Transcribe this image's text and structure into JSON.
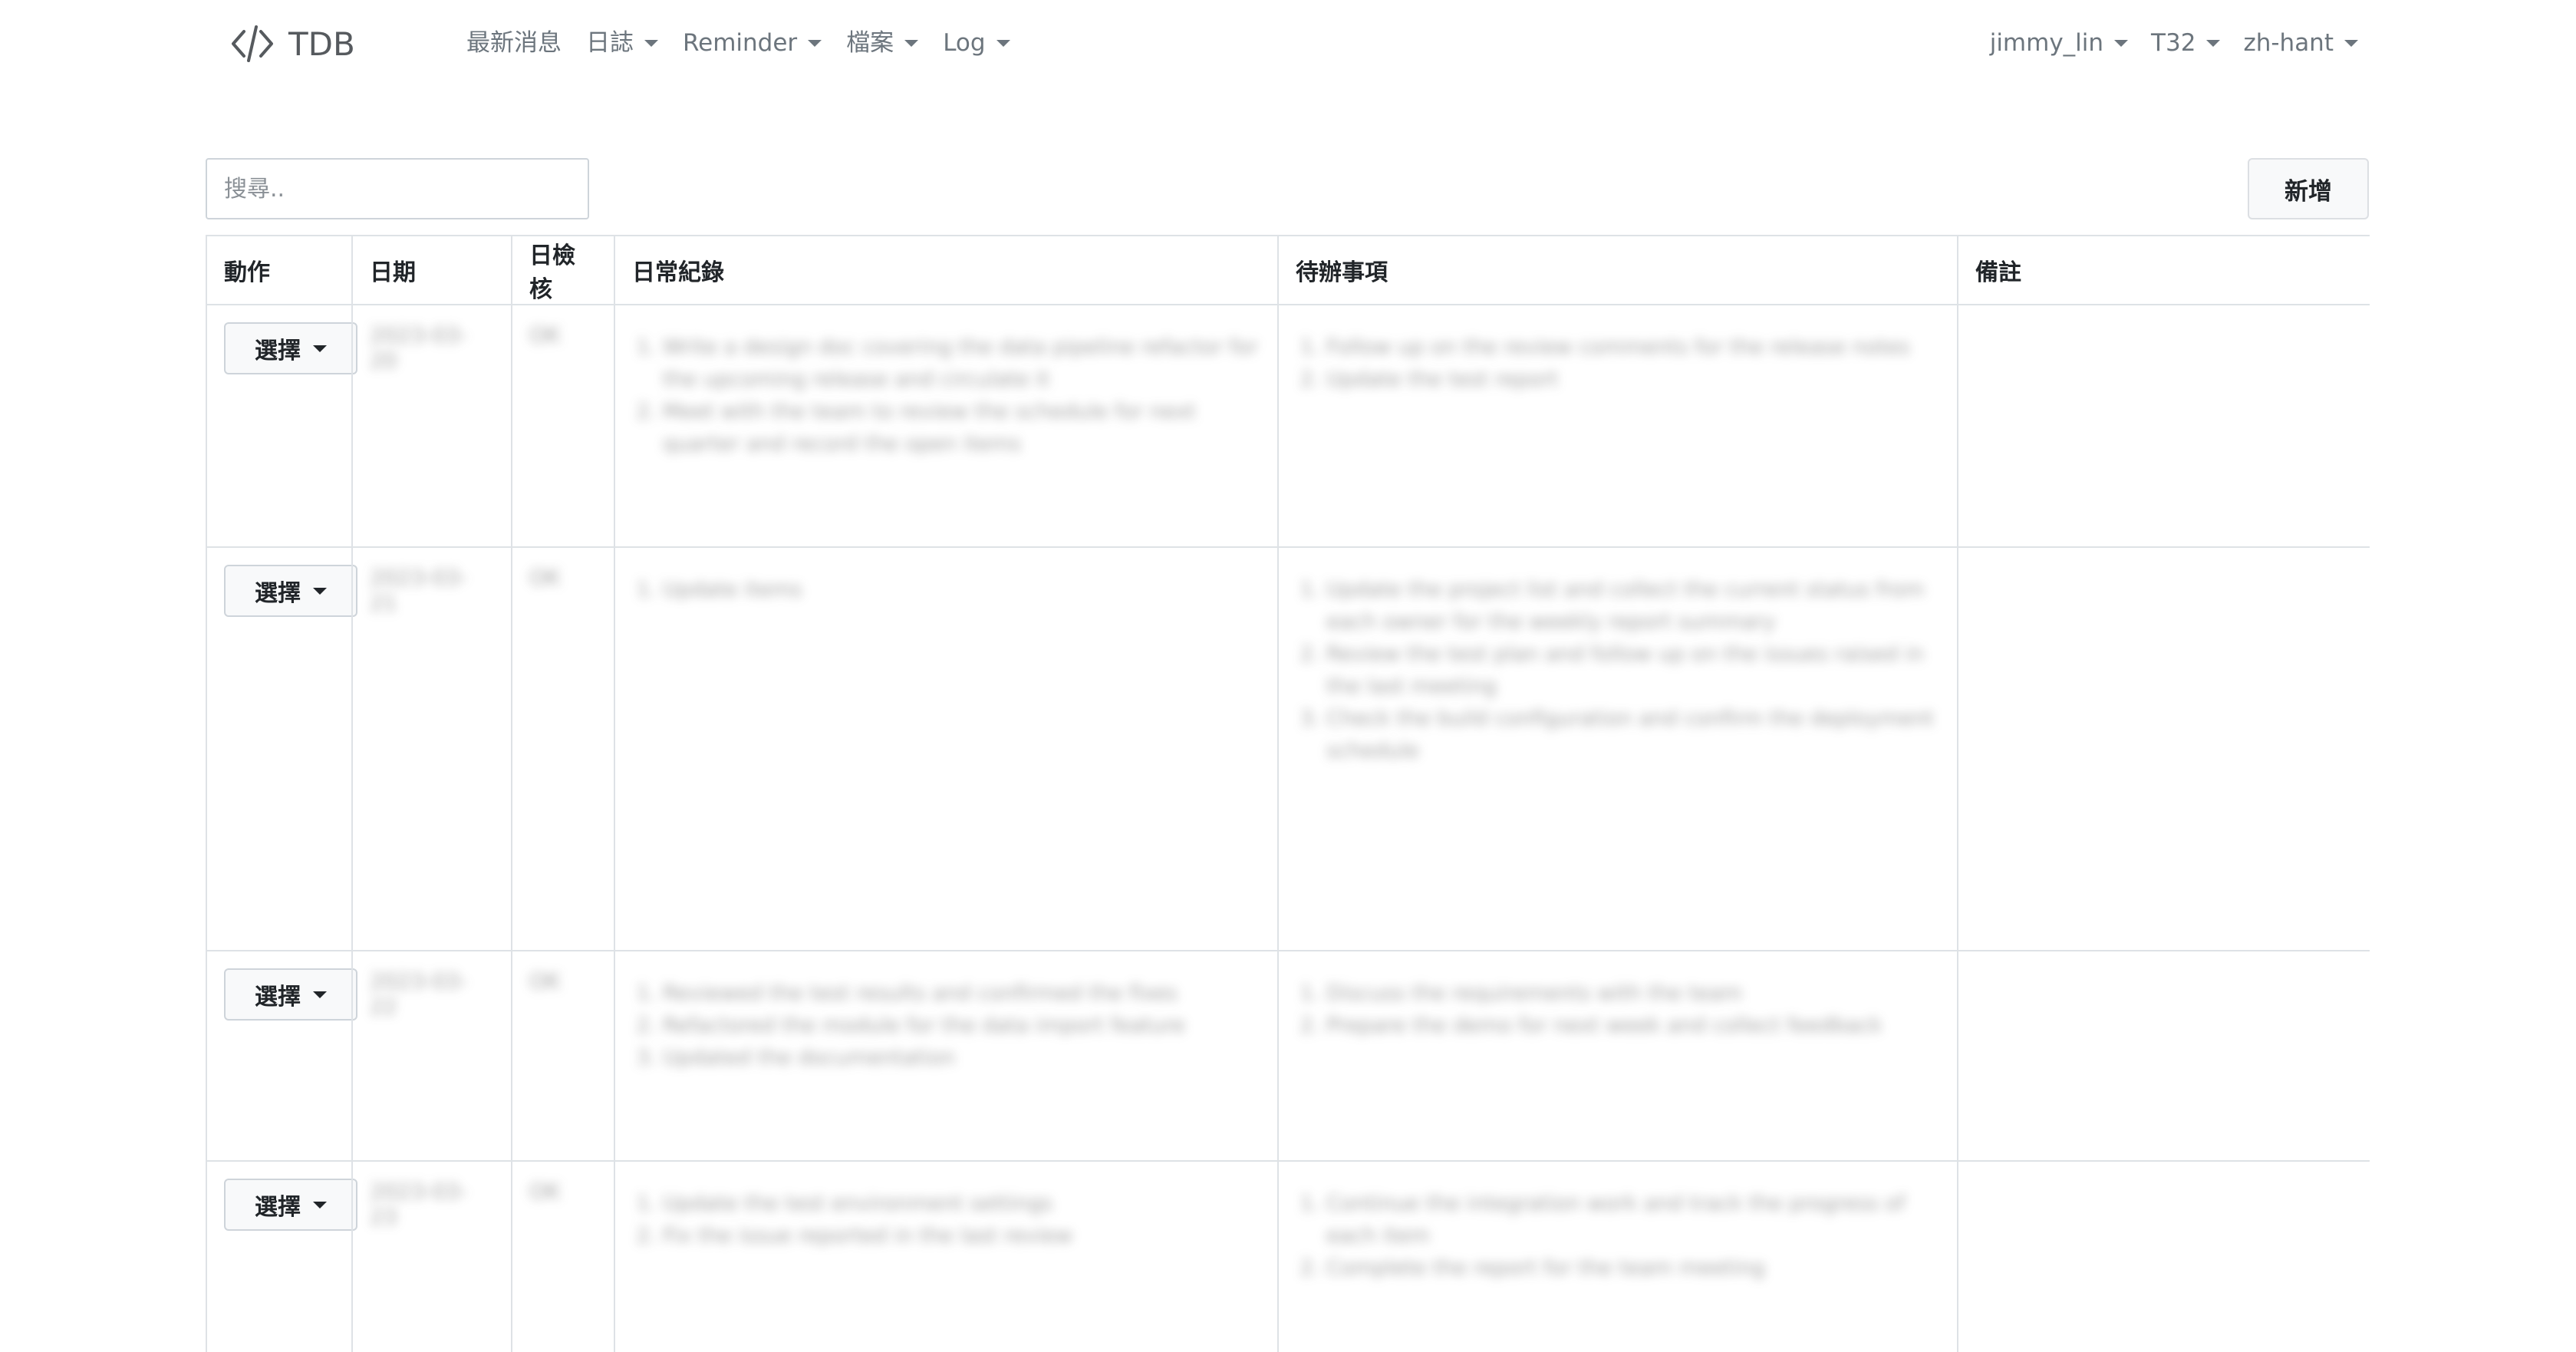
{
  "brand": {
    "text": "TDB"
  },
  "nav": {
    "left": [
      {
        "label": "最新消息",
        "dropdown": false
      },
      {
        "label": "日誌",
        "dropdown": true
      },
      {
        "label": "Reminder",
        "dropdown": true
      },
      {
        "label": "檔案",
        "dropdown": true
      },
      {
        "label": "Log",
        "dropdown": true
      }
    ],
    "right": [
      {
        "label": "jimmy_lin",
        "dropdown": true
      },
      {
        "label": "T32",
        "dropdown": true
      },
      {
        "label": "zh-hant",
        "dropdown": true
      }
    ]
  },
  "search": {
    "placeholder": "搜尋.."
  },
  "add_button": "新增",
  "table": {
    "headers": [
      "動作",
      "日期",
      "日檢核",
      "日常紀錄",
      "待辦事項",
      "備註"
    ],
    "rows": [
      {
        "action": "選擇",
        "date": "2023-03-20",
        "check": "OK",
        "records": [
          "Write a design doc covering the data pipeline refactor for the upcoming release and circulate it",
          "Meet with the team to review the schedule for next quarter and record the open items"
        ],
        "todos": [
          "Follow up on the review comments for the release notes",
          "Update the test report"
        ],
        "remark": ""
      },
      {
        "action": "選擇",
        "date": "2023-03-21",
        "check": "OK",
        "records": [
          "Update items"
        ],
        "todos": [
          "Update the project list and collect the current status from each owner for the weekly report summary",
          "Review the test plan and follow up on the issues raised in the last meeting",
          "Check the build configuration and confirm the deployment schedule"
        ],
        "remark": ""
      },
      {
        "action": "選擇",
        "date": "2023-03-22",
        "check": "OK",
        "records": [
          "Reviewed the test results and confirmed the fixes",
          "Refactored the module for the data import feature",
          "Updated the documentation"
        ],
        "todos": [
          "Discuss the requirements with the team",
          "Prepare the demo for next week and collect feedback"
        ],
        "remark": ""
      },
      {
        "action": "選擇",
        "date": "2023-03-23",
        "check": "OK",
        "records": [
          "Update the test environment settings",
          "Fix the issue reported in the last review"
        ],
        "todos": [
          "Continue the integration work and track the progress of each item",
          "Complete the report for the team meeting"
        ],
        "remark": ""
      }
    ]
  },
  "colors": {
    "border": "#dee2e6",
    "nav_text": "#6c757d",
    "button_bg": "#f8f9fa"
  }
}
